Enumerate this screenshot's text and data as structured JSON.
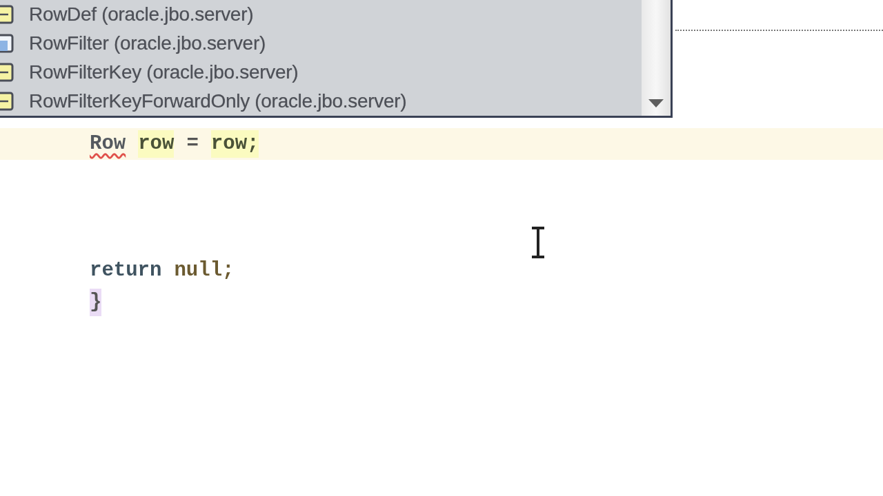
{
  "completion_popup": {
    "items": [
      {
        "kind": "class",
        "label": "RowDef (oracle.jbo.server)"
      },
      {
        "kind": "interface",
        "label": "RowFilter (oracle.jbo.server)"
      },
      {
        "kind": "class",
        "label": "RowFilterKey (oracle.jbo.server)"
      },
      {
        "kind": "class",
        "label": "RowFilterKeyForwardOnly (oracle.jbo.server)"
      }
    ]
  },
  "editor": {
    "lines": [
      {
        "current": true,
        "tokens": [
          {
            "text": "Row",
            "kind": "type",
            "highlighted": false,
            "error": true
          },
          {
            "text": "row",
            "kind": "ident",
            "highlighted": true,
            "error": false
          },
          {
            "text": "=",
            "kind": "op",
            "highlighted": false,
            "error": false
          },
          {
            "text": "row;",
            "kind": "ident",
            "highlighted": true,
            "error": false
          }
        ]
      },
      {
        "current": false
      },
      {
        "current": false
      },
      {
        "current": false
      },
      {
        "current": false,
        "tokens": [
          {
            "text": "return",
            "kind": "keyword",
            "highlighted": false,
            "error": false
          },
          {
            "text": "null;",
            "kind": "literal",
            "highlighted": false,
            "error": false
          }
        ]
      },
      {
        "current": false,
        "tokens": [
          {
            "text": "}",
            "kind": "brace",
            "highlighted": true,
            "error": false
          }
        ]
      }
    ]
  }
}
